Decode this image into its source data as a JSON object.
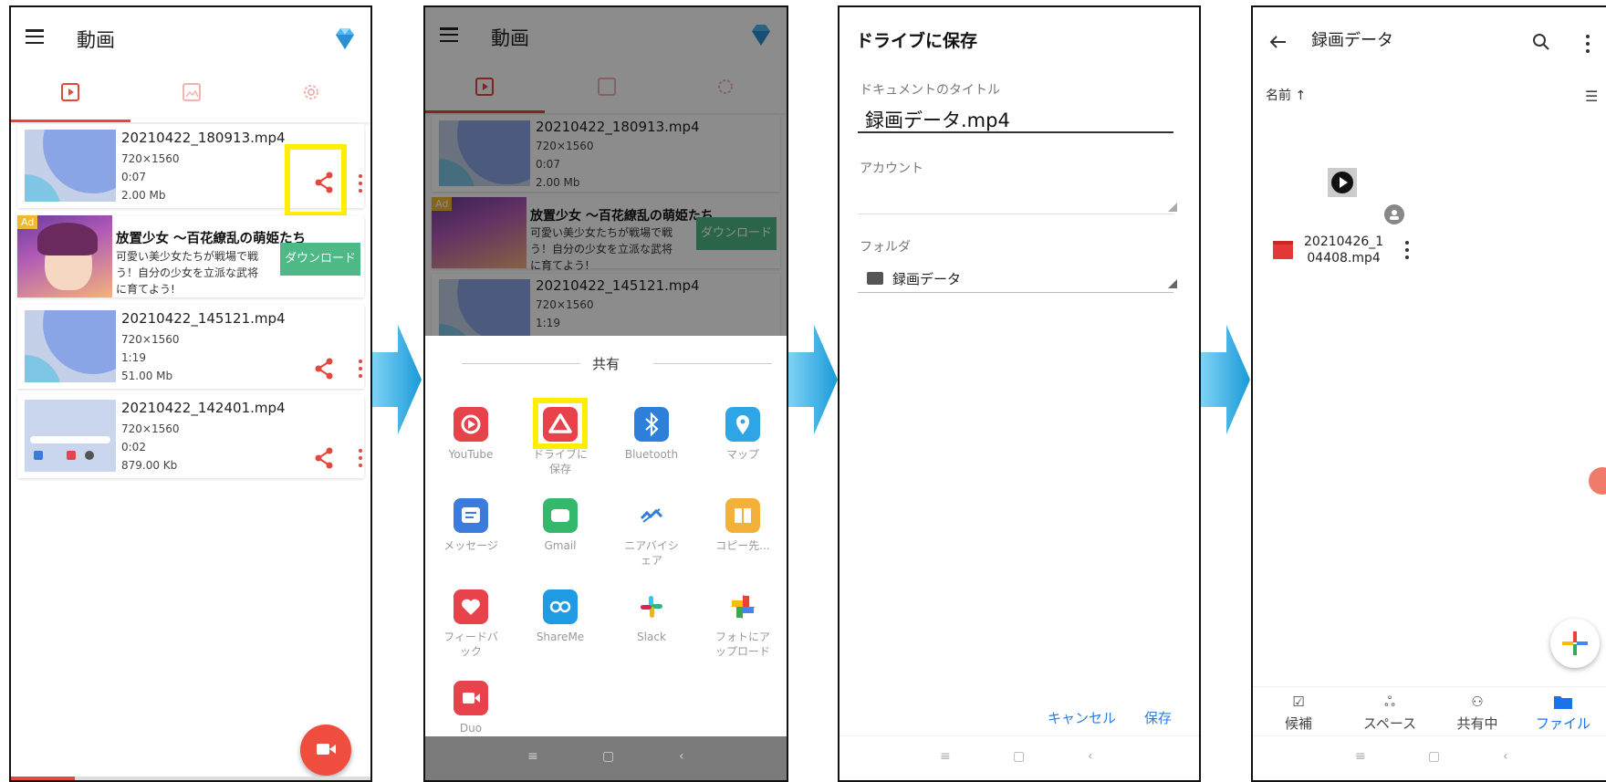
{
  "colors": {
    "accent": "#e4473b",
    "highlight": "#ffee00",
    "link": "#2b7de1",
    "drive_blue": "#1a73e8",
    "ad_button": "#4eb887"
  },
  "screen1": {
    "title": "動画",
    "videos": [
      {
        "name": "20210422_180913.mp4",
        "resolution": "720×1560",
        "duration": "0:07",
        "size": "2.00 Mb"
      },
      {
        "name": "20210422_145121.mp4",
        "resolution": "720×1560",
        "duration": "1:19",
        "size": "51.00 Mb"
      },
      {
        "name": "20210422_142401.mp4",
        "resolution": "720×1560",
        "duration": "0:02",
        "size": "879.00 Kb"
      }
    ],
    "ad": {
      "badge": "Ad",
      "title": "放置少女 〜百花繚乱の萌姫たち",
      "description": "可愛い美少女たちが戦場で戦う！自分の少女を立派な武将に育てよう!",
      "button": "ダウンロード"
    }
  },
  "screen2": {
    "share_title": "共有",
    "apps": [
      {
        "label": "YouTube",
        "color": "#e8424b"
      },
      {
        "label": "ドライブに保存",
        "color": "#e8424b"
      },
      {
        "label": "Bluetooth",
        "color": "#2d7fd9"
      },
      {
        "label": "マップ",
        "color": "#2ea6e6"
      },
      {
        "label": "メッセージ",
        "color": "#3a7bdb"
      },
      {
        "label": "Gmail",
        "color": "#35b86b"
      },
      {
        "label": "ニアバイシェア",
        "color": "#ffffff"
      },
      {
        "label": "コピー先...",
        "color": "#f3b13a"
      },
      {
        "label": "フィードバック",
        "color": "#e8424b"
      },
      {
        "label": "ShareMe",
        "color": "#1e9be3"
      },
      {
        "label": "Slack",
        "color": "#ffffff"
      },
      {
        "label": "フォトにアップロード",
        "color": "#ffffff"
      },
      {
        "label": "Duo",
        "color": "#e8424b"
      }
    ]
  },
  "screen3": {
    "title": "ドライブに保存",
    "doc_title_label": "ドキュメントのタイトル",
    "doc_title_value": "録画データ.mp4",
    "account_label": "アカウント",
    "folder_label": "フォルダ",
    "folder_value": "録画データ",
    "cancel": "キャンセル",
    "save": "保存"
  },
  "screen4": {
    "title": "録画データ",
    "sort_label": "名前 ↑",
    "file_name_line1": "20210426_1",
    "file_name_line2": "04408.mp4",
    "bottom_nav": [
      {
        "label": "候補",
        "active": false
      },
      {
        "label": "スペース",
        "active": false
      },
      {
        "label": "共有中",
        "active": false
      },
      {
        "label": "ファイル",
        "active": true
      }
    ]
  }
}
